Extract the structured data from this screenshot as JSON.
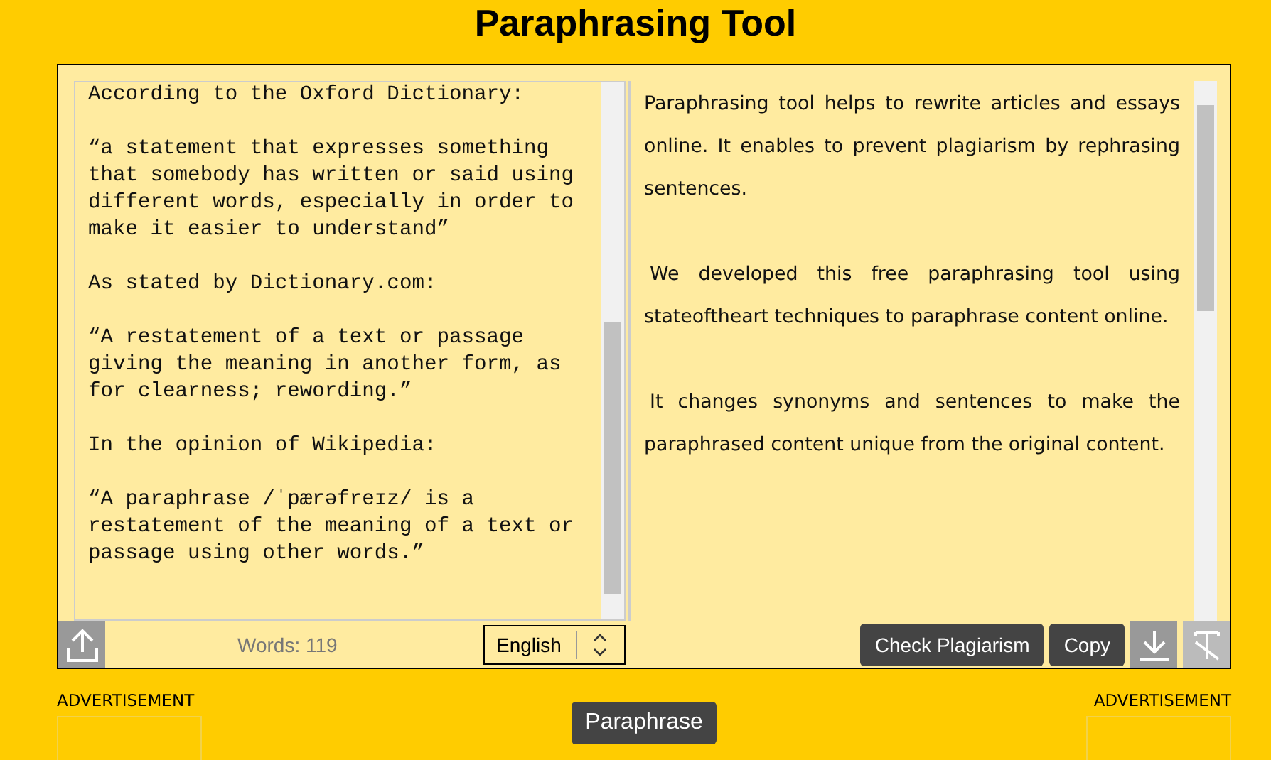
{
  "title": "Paraphrasing Tool",
  "input": {
    "paragraphs": [
      "According to the Oxford Dictionary:",
      "“a statement that expresses something that somebody has written or said using different words, especially in order to make it easier to understand”",
      "As stated by Dictionary.com:",
      "“A restatement of a text or passage giving the meaning in another form, as for clearness; rewording.”",
      "In the opinion of Wikipedia:",
      "“A paraphrase /ˈpærəfreɪz/ is a restatement of the meaning of a text or passage using other words.”"
    ]
  },
  "output": {
    "paragraphs": [
      "Paraphrasing tool helps to rewrite articles and essays online. It enables to prevent plagiarism by rephrasing sentences.",
      "We developed this free paraphrasing tool using stateoftheart techniques to paraphrase content online.",
      "It changes synonyms and sentences to make the paraphrased content unique from the original content."
    ]
  },
  "word_count": "Words: 119",
  "language": "English",
  "buttons": [
    "Check Plagiarism",
    "Copy"
  ],
  "ads": [
    "ADVERTISEMENT",
    "ADVERTISEMENT"
  ],
  "paraphrase_button": "Paraphrase"
}
